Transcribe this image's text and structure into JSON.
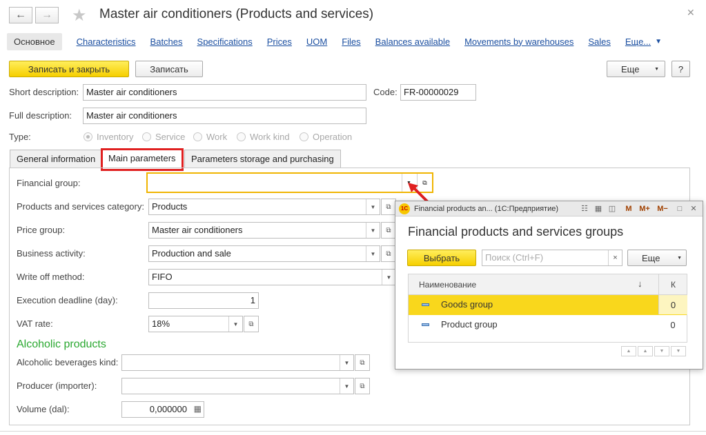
{
  "window": {
    "title": "Master air conditioners (Products and services)",
    "back_icon": "arrow-left-icon",
    "forward_icon": "arrow-right-icon",
    "favorite_icon": "star-icon",
    "close_icon": "close-icon"
  },
  "tabs": [
    {
      "label": "Основное",
      "active": true
    },
    {
      "label": "Characteristics"
    },
    {
      "label": "Batches"
    },
    {
      "label": "Specifications"
    },
    {
      "label": "Prices"
    },
    {
      "label": "UOM"
    },
    {
      "label": "Files"
    },
    {
      "label": "Balances available"
    },
    {
      "label": "Movements by warehouses"
    },
    {
      "label": "Sales"
    },
    {
      "label": "Еще..."
    }
  ],
  "toolbar": {
    "save_close": "Записать и закрыть",
    "save": "Записать",
    "more": "Еще",
    "help": "?"
  },
  "header_fields": {
    "short_desc_label": "Short description:",
    "short_desc_value": "Master air conditioners",
    "code_label": "Code:",
    "code_value": "FR-00000029",
    "full_desc_label": "Full description:",
    "full_desc_value": "Master air conditioners",
    "type_label": "Type:",
    "type_options": [
      "Inventory",
      "Service",
      "Work",
      "Work kind",
      "Operation"
    ],
    "type_selected": "Inventory"
  },
  "form_tabs": [
    {
      "label": "General information"
    },
    {
      "label": "Main parameters",
      "active": true
    },
    {
      "label": "Parameters storage and purchasing"
    }
  ],
  "main_params": {
    "financial_group_label": "Financial group:",
    "financial_group_value": "",
    "category_label": "Products and services category:",
    "category_value": "Products",
    "price_group_label": "Price group:",
    "price_group_value": "Master air conditioners",
    "business_activity_label": "Business activity:",
    "business_activity_value": "Production and sale",
    "write_off_label": "Write off method:",
    "write_off_value": "FIFO",
    "deadline_label": "Execution deadline (day):",
    "deadline_value": "1",
    "vat_label": "VAT rate:",
    "vat_value": "18%"
  },
  "alcohol": {
    "section_title": "Alcoholic products",
    "kind_label": "Alcoholic beverages kind:",
    "kind_value": "",
    "producer_label": "Producer (importer):",
    "producer_value": "",
    "volume_label": "Volume (dal):",
    "volume_value": "0,000000"
  },
  "popup": {
    "window_title": "Financial products an...  (1С:Предприятие)",
    "heading": "Financial products and services groups",
    "select_btn": "Выбрать",
    "search_placeholder": "Поиск (Ctrl+F)",
    "more_btn": "Еще",
    "col_name": "Наименование",
    "col_k": "К",
    "sort_indicator": "↓",
    "titlebar_buttons": [
      "M",
      "M+",
      "M−"
    ],
    "rows": [
      {
        "name": "Goods group",
        "k": "0",
        "selected": true
      },
      {
        "name": "Product group",
        "k": "0"
      }
    ]
  },
  "colors": {
    "accent_yellow": "#f6cf00",
    "link_blue": "#1a4ea0",
    "highlight_red": "#e02020",
    "section_green": "#2aa830",
    "selected_row": "#f9d71c"
  }
}
